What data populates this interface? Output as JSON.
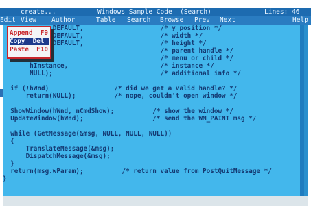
{
  "colors": {
    "titlebar": "#1d6bb0",
    "menubar": "#2a7cc1",
    "editor_bg": "#43b7ec",
    "code_text": "#143a73",
    "dropdown_bg": "#f4f4f6",
    "dropdown_text": "#c8262b",
    "dropdown_selected_bg": "#1d3a8c"
  },
  "titlebar": {
    "left": "create...",
    "center": "Windows Sample Code  (Search)",
    "right": "Lines: 46"
  },
  "menu": {
    "items": [
      "Edit",
      "View",
      "Author",
      "Table",
      "Search",
      "Browse",
      "Prev",
      "Next",
      "Help"
    ]
  },
  "edit_menu": {
    "items": [
      {
        "label": "Append  F9"
      },
      {
        "label": "Copy  Del"
      },
      {
        "label": "Paste  F10"
      }
    ],
    "selected_index": 1
  },
  "code": {
    "lines": [
      "             DEFAULT,                    /* y position */",
      "             DEFAULT,                    /* width */",
      "             DEFAULT,                    /* height */",
      "                                         /* parent handle */",
      "                                         /* menu or child */",
      "       hInstance,                        /* instance */",
      "       NULL);                            /* additional info */",
      "",
      "  if (!hWnd)                 /* did we get a valid handle? */",
      "      return(NULL);          /* nope, couldn't open window */",
      "",
      "  ShowWindow(hWnd, nCmdShow);          /* show the window */",
      "  UpdateWindow(hWnd);                  /* send the WM_PAINT msg */",
      "",
      "  while (GetMessage(&msg, NULL, NULL, NULL))",
      "  {",
      "      TranslateMessage(&msg);",
      "      DispatchMessage(&msg);",
      "  }",
      "  return(msg.wParam);          /* return value from PostQuitMessage */",
      "}"
    ]
  }
}
